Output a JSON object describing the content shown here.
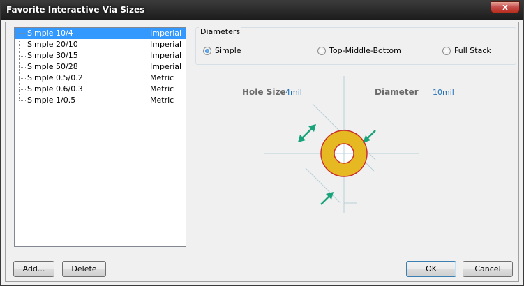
{
  "window": {
    "title": "Favorite Interactive Via Sizes",
    "close_glyph": "x"
  },
  "via_list": [
    {
      "name": "Simple 10/4",
      "units": "Imperial",
      "selected": true
    },
    {
      "name": "Simple 20/10",
      "units": "Imperial"
    },
    {
      "name": "Simple 30/15",
      "units": "Imperial"
    },
    {
      "name": "Simple 50/28",
      "units": "Imperial"
    },
    {
      "name": "Simple 0.5/0.2",
      "units": "Metric"
    },
    {
      "name": "Simple 0.6/0.3",
      "units": "Metric"
    },
    {
      "name": "Simple 1/0.5",
      "units": "Metric"
    }
  ],
  "diameters": {
    "label": "Diameters",
    "options": [
      "Simple",
      "Top-Middle-Bottom",
      "Full Stack"
    ],
    "selected": "Simple"
  },
  "diagram": {
    "hole_size_label": "Hole Size",
    "hole_size_value": "4mil",
    "diameter_label": "Diameter",
    "diameter_value": "10mil",
    "colors": {
      "pad": "#e6b822",
      "pad_edge": "#c8322a",
      "arrow": "#1aa37a",
      "line": "#b8d0d8"
    }
  },
  "buttons": {
    "add": "Add...",
    "delete": "Delete",
    "ok": "OK",
    "cancel": "Cancel"
  }
}
